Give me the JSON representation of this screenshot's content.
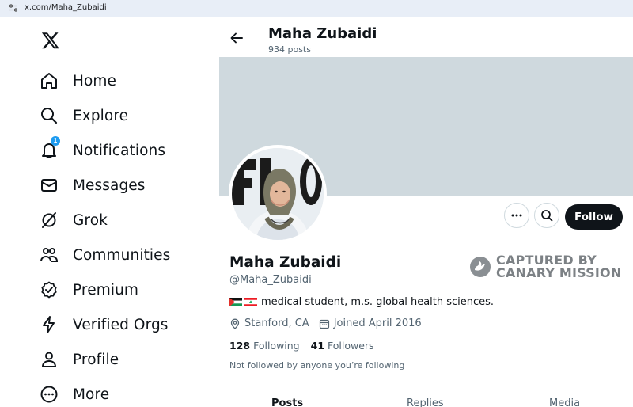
{
  "browser": {
    "url": "x.com/Maha_Zubaidi"
  },
  "nav": {
    "items": [
      {
        "label": "Home"
      },
      {
        "label": "Explore"
      },
      {
        "label": "Notifications",
        "badge": "1"
      },
      {
        "label": "Messages"
      },
      {
        "label": "Grok"
      },
      {
        "label": "Communities"
      },
      {
        "label": "Premium"
      },
      {
        "label": "Verified Orgs"
      },
      {
        "label": "Profile"
      },
      {
        "label": "More"
      }
    ]
  },
  "header": {
    "name": "Maha Zubaidi",
    "posts_count": "934 posts"
  },
  "profile": {
    "name": "Maha Zubaidi",
    "handle": "@Maha_Zubaidi",
    "bio": "medical student, m.s. global health sciences.",
    "location": "Stanford, CA",
    "joined": "Joined April 2016",
    "following_count": "128",
    "following_label": "Following",
    "followers_count": "41",
    "followers_label": "Followers",
    "not_followed": "Not followed by anyone you’re following",
    "follow_label": "Follow"
  },
  "watermark": {
    "line1": "CAPTURED BY",
    "line2": "CANARY MISSION"
  },
  "tabs": [
    {
      "label": "Posts",
      "active": true
    },
    {
      "label": "Replies",
      "active": false
    },
    {
      "label": "Media",
      "active": false
    }
  ],
  "colors": {
    "accent": "#1d9bf0",
    "banner": "#cfd9de",
    "follow_bg": "#0f1419"
  }
}
